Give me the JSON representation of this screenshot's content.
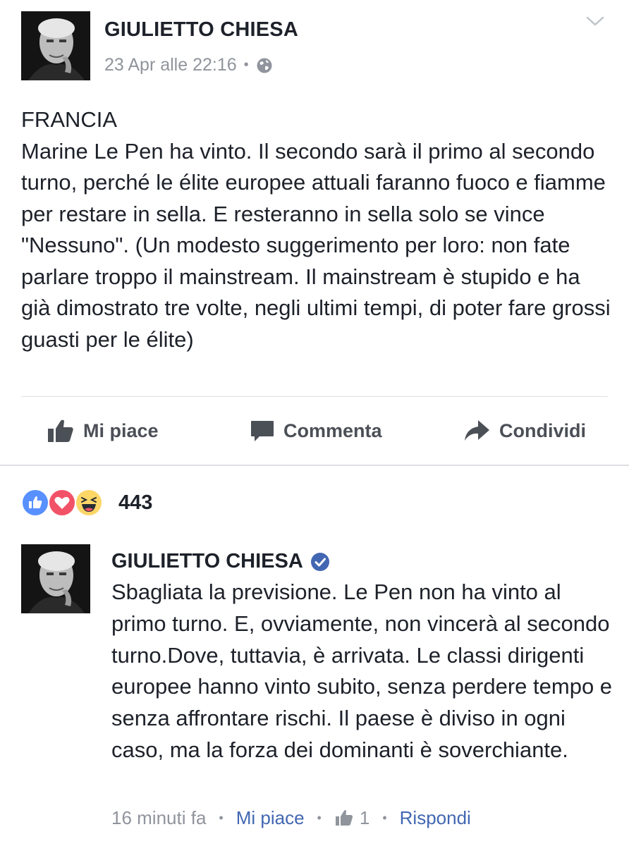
{
  "post": {
    "author": "GIULIETTO CHIESA",
    "timestamp": "23 Apr alle 22:16",
    "privacy_icon": "globe-icon",
    "menu_icon": "chevron-down-icon",
    "text": "FRANCIA\nMarine Le Pen ha vinto. Il secondo sarà il primo al secondo turno, perché le élite europee attuali faranno fuoco e fiamme per restare in sella. E resteranno in sella solo se vince \"Nessuno\". (Un modesto suggerimento per loro: non fate parlare troppo il mainstream. Il mainstream è stupido e ha già dimostrato tre volte, negli ultimi tempi, di poter fare grossi guasti per le élite)"
  },
  "actions": {
    "like_label": "Mi piace",
    "comment_label": "Commenta",
    "share_label": "Condividi"
  },
  "reactions": {
    "count": "443",
    "types": [
      "like",
      "love",
      "haha"
    ]
  },
  "comment": {
    "author": "GIULIETTO CHIESA",
    "verified": true,
    "text": "Sbagliata la previsione. Le Pen non ha vinto al primo turno. E, ovviamente, non vincerà al secondo turno.Dove, tuttavia, è arrivata. Le classi dirigenti europee hanno vinto subito, senza perdere tempo e senza affrontare rischi. Il paese è diviso in ogni caso, ma la forza dei dominanti è soverchiante.",
    "time": "16 minuti fa",
    "like_label": "Mi piace",
    "like_count": "1",
    "reply_label": "Rispondi"
  },
  "colors": {
    "text": "#1d2129",
    "meta": "#90949c",
    "link": "#4267b2",
    "action": "#4b4f56",
    "verified": "#4267b2"
  }
}
